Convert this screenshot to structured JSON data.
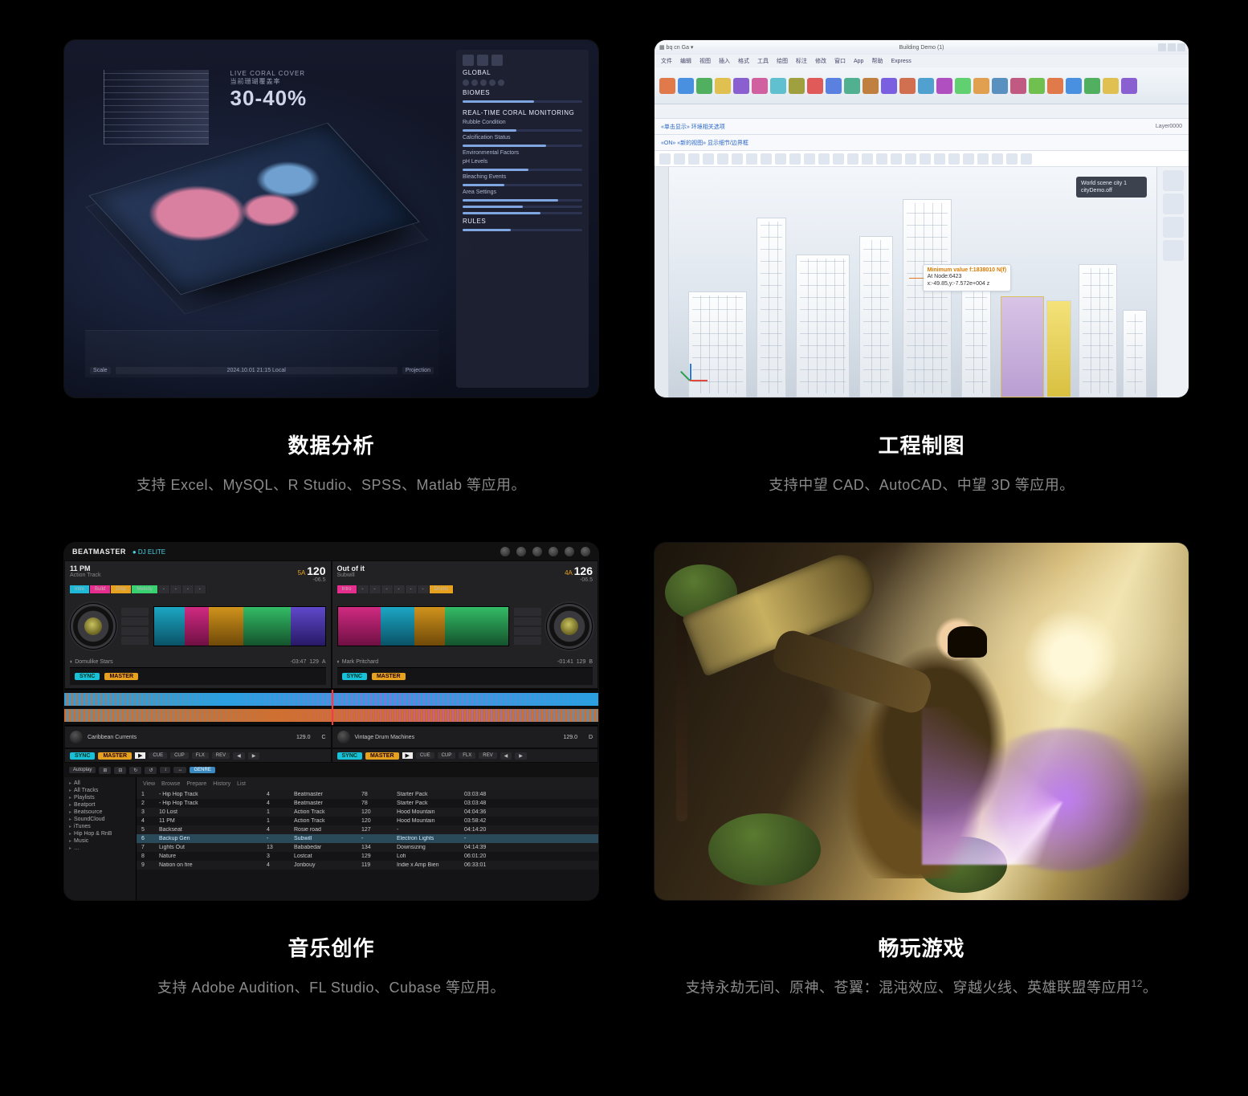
{
  "cards": [
    {
      "title": "数据分析",
      "subtitle": "支持 Excel、MySQL、R Studio、SPSS、Matlab 等应用。",
      "viz": {
        "headline_label": "LIVE CORAL COVER",
        "headline_sub": "当前珊瑚覆盖率",
        "headline_value": "30-40%",
        "panel_global": "GLOBAL",
        "panel_biomes": "BIOMES",
        "section_monitor": "REAL-TIME CORAL MONITORING",
        "rubble": "Rubble Condition",
        "calcif": "Calcification Status",
        "env": "Environmental Factors",
        "ph": "pH Levels",
        "bleach": "Bleaching Events",
        "area": "Area Settings",
        "rules": "RULES",
        "footer_proj": "Projection",
        "footer_scale": "Scale",
        "footer_time": "2024.10.01   21:15 Local"
      }
    },
    {
      "title": "工程制图",
      "subtitle": "支持中望 CAD、AutoCAD、中望 3D 等应用。",
      "cad": {
        "titlebar": "Building Demo (1)",
        "menus": [
          "文件",
          "编辑",
          "视图",
          "插入",
          "格式",
          "工具",
          "绘图",
          "标注",
          "修改",
          "窗口",
          "App",
          "帮助",
          "Express"
        ],
        "breadcrumb1": "«单击显示» 环境相关选项",
        "breadcrumb2": "«ON» «新的视图» 显示细节/边界框",
        "layer": "Layer0000",
        "panel_line1": "World scene city 1",
        "panel_line2": "cityDemo.off",
        "callout_line1": "Minimum value f:1838010 N(f)",
        "callout_line2": "At Node:6423",
        "callout_line3": "x:-49.85,y:-7.572e+004 z"
      }
    },
    {
      "title": "音乐创作",
      "subtitle": "支持 Adobe Audition、FL Studio、Cubase 等应用。",
      "dj": {
        "brand": "BEATMASTER",
        "mode": "DJ ELITE",
        "deckA": {
          "title": "11 PM",
          "artist": "Action Track",
          "key": "5A",
          "bpm": "120",
          "gain": "-06.5"
        },
        "deckB": {
          "title": "Out of it",
          "artist": "Subwill",
          "key": "4A",
          "bpm": "126",
          "gain": "-06.5"
        },
        "tabs": [
          "Intro",
          "Build",
          "Drop",
          "Melody",
          "-",
          "-",
          "-",
          "-"
        ],
        "tabsB": [
          "Intro",
          "-",
          "-",
          "-",
          "-",
          "-",
          "-",
          "Drums"
        ],
        "trackA": {
          "name": "Domulike Stars",
          "time": "-03:47",
          "bpm": "129",
          "deck": "A"
        },
        "trackB": {
          "name": "Mark Pritchard",
          "time": "-01:41",
          "bpm": "129",
          "deck": "B"
        },
        "sync": "SYNC",
        "master": "MASTER",
        "deckC": {
          "name": "Caribbean Currents",
          "bpm": "129.0",
          "deck": "C"
        },
        "deckD": {
          "name": "Vintage Drum Machines",
          "bpm": "129.0",
          "deck": "D"
        },
        "footBtns": [
          "CUE",
          "CUP",
          "FLX",
          "REV",
          "◀",
          "▶"
        ],
        "browserTabs": [
          "View",
          "Browse",
          "Prepare",
          "History",
          "List"
        ],
        "filters": [
          "Autoplay",
          "⊞",
          "⊟",
          "↻",
          "↺",
          "↕",
          "↔"
        ],
        "genre": "GENRE",
        "tree": [
          "All",
          "All Tracks",
          "Playlists",
          "Beatport",
          "Beatsource",
          "SoundCloud",
          "iTunes",
          "Hip Hop & RnB",
          "Music",
          "…"
        ],
        "rows": [
          [
            "1",
            "- Hip Hop Track",
            "4",
            "Beatmaster",
            "78",
            "Starter Pack",
            "03:03:48"
          ],
          [
            "2",
            "- Hip Hop Track",
            "4",
            "Beatmaster",
            "78",
            "Starter Pack",
            "03:03:48"
          ],
          [
            "3",
            "10 Lost",
            "1",
            "Action Track",
            "120",
            "Hood Mountain",
            "04:04:36"
          ],
          [
            "4",
            "11 PM",
            "1",
            "Action Track",
            "120",
            "Hood Mountain",
            "03:58:42"
          ],
          [
            "5",
            "Backseat",
            "4",
            "Rosie road",
            "127",
            "-",
            "04:14:20"
          ],
          [
            "6",
            "Backup Gen",
            "-",
            "Subwill",
            "-",
            "Electron Lights",
            "-"
          ],
          [
            "7",
            "Lights Out",
            "13",
            "Bababedar",
            "134",
            "Downsizing",
            "04:14:39"
          ],
          [
            "8",
            "Nature",
            "3",
            "Lostcat",
            "129",
            "Lofi",
            "06:01:20"
          ],
          [
            "9",
            "Nation on fire",
            "4",
            "Jonbouy",
            "119",
            "Indie x Amp Bien",
            "06:33:01"
          ]
        ]
      }
    },
    {
      "title": "畅玩游戏",
      "subtitle_pre": "支持永劫无间、原神、苍翼：混沌效应、穿越火线、英雄联盟等应用",
      "subtitle_sup": "12",
      "subtitle_post": "。"
    }
  ]
}
